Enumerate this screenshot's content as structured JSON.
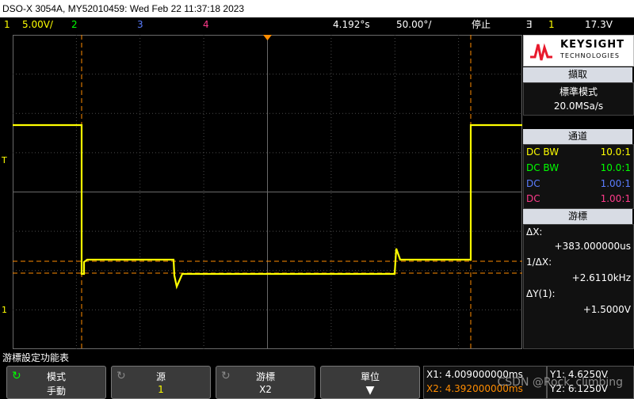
{
  "titlebar": {
    "text": "DSO-X 3054A, MY52010459: Wed Feb 22 11:37:18 2023"
  },
  "status": {
    "ch1_num": "1",
    "ch1_scale": "5.00V/",
    "ch2_num": "2",
    "ch3_num": "3",
    "ch4_num": "4",
    "time_delay": "4.192°s",
    "time_scale": "50.00°/",
    "run_state": "停止",
    "trigger_icon": "Ǝ",
    "trigger_ch": "1",
    "trigger_level": "17.3V"
  },
  "colors": {
    "ch1": "#ffff00",
    "ch2": "#00ff00",
    "ch3": "#5a7dff",
    "ch4": "#ff3b8b",
    "cursor": "#ff8c00",
    "grid": "#6a6a6a"
  },
  "brand": {
    "name": "KEYSIGHT",
    "sub": "TECHNOLOGIES"
  },
  "acquire": {
    "title": "擷取",
    "mode": "標準模式",
    "rate": "20.0MSa/s"
  },
  "channels": {
    "title": "通道",
    "rows": [
      {
        "coupling": "DC BW",
        "ratio": "10.0:1",
        "color": "#ffff00"
      },
      {
        "coupling": "DC BW",
        "ratio": "10.0:1",
        "color": "#00ff00"
      },
      {
        "coupling": "DC",
        "ratio": "1.00:1",
        "color": "#5a7dff"
      },
      {
        "coupling": "DC",
        "ratio": "1.00:1",
        "color": "#ff3b8b"
      }
    ]
  },
  "cursors": {
    "title": "游標",
    "dx_label": "ΔX:",
    "dx_value": "+383.000000us",
    "inv_label": "1/ΔX:",
    "inv_value": "+2.6110kHz",
    "dy_label": "ΔY(1):",
    "dy_value": "+1.5000V",
    "dy_ch": "1"
  },
  "menu_title": "游標設定功能表",
  "softkeys": {
    "mode_l1": "模式",
    "mode_l2": "手動",
    "source_l1": "源",
    "source_l2": "1",
    "cursors_l1": "游標",
    "cursors_l2": "X2",
    "units_l1": "單位"
  },
  "readouts": {
    "x1": "X1: 4.009000000ms",
    "x2": "X2: 4.392000000ms",
    "y1": "Y1: 4.6250V",
    "y2": "Y2: 6.1250V"
  },
  "watermark": "CSDN @Rock_climbing",
  "markers": {
    "ch1_marker": "1",
    "trig_marker": "T"
  }
}
